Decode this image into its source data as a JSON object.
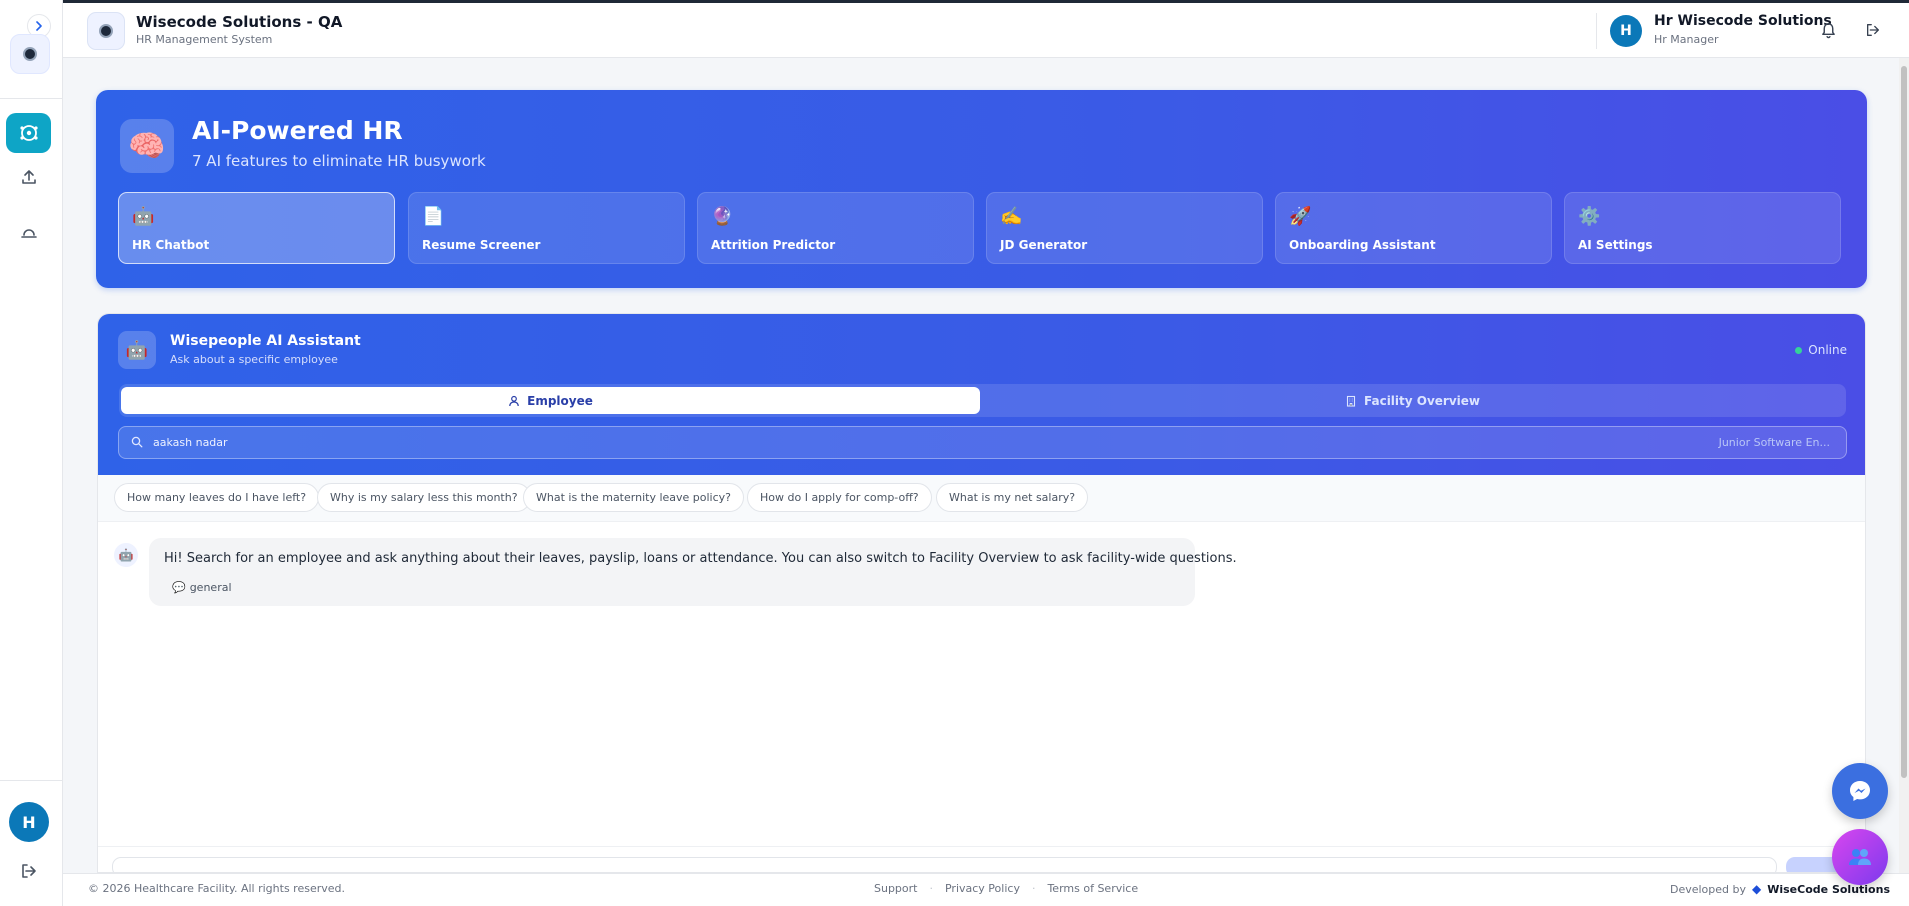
{
  "app": {
    "title": "Wisecode Solutions - QA",
    "subtitle": "HR Management System"
  },
  "user": {
    "initial": "H",
    "name": "Hr Wisecode Solutions",
    "role": "Hr Manager"
  },
  "sidebar": {
    "toggle_icon": "chevron-right-icon",
    "items": [
      {
        "name": "ai-icon",
        "active": true
      },
      {
        "name": "upload-icon",
        "active": false
      },
      {
        "name": "sunset-icon",
        "active": false
      }
    ],
    "avatar_initial": "H"
  },
  "hero": {
    "title": "AI-Powered HR",
    "subtitle": "7 AI features to eliminate HR busywork",
    "icon": "🧠",
    "features": [
      {
        "emoji": "🤖",
        "label": "HR Chatbot",
        "active": true
      },
      {
        "emoji": "📄",
        "label": "Resume Screener",
        "active": false
      },
      {
        "emoji": "🔮",
        "label": "Attrition Predictor",
        "active": false
      },
      {
        "emoji": "✍️",
        "label": "JD Generator",
        "active": false
      },
      {
        "emoji": "🚀",
        "label": "Onboarding Assistant",
        "active": false
      },
      {
        "emoji": "⚙️",
        "label": "AI Settings",
        "active": false
      }
    ]
  },
  "assistant": {
    "icon": "🤖",
    "title": "Wisepeople AI Assistant",
    "subtitle": "Ask about a specific employee",
    "status": "Online",
    "tabs": [
      {
        "label": "Employee",
        "active": true
      },
      {
        "label": "Facility Overview",
        "active": false
      }
    ],
    "search": {
      "value": "aakash nadar",
      "role": "Junior Software En..."
    },
    "suggestions": [
      "How many leaves do I have left?",
      "Why is my salary less this month?",
      "What is the maternity leave policy?",
      "How do I apply for comp-off?",
      "What is my net salary?"
    ],
    "messages": [
      {
        "avatar": "🤖",
        "text": "Hi! Search for an employee and ask anything about their leaves, payslip, loans or attendance. You can also switch to Facility Overview to ask facility-wide questions.",
        "tag": "general",
        "tag_icon": "💬"
      }
    ]
  },
  "footer": {
    "copyright": "© 2026 Healthcare Facility. All rights reserved.",
    "links": [
      "Support",
      "Privacy Policy",
      "Terms of Service"
    ],
    "separator": "·",
    "developed_by": "Developed by",
    "brand": "WiseCode Solutions"
  },
  "colors": {
    "primary": "#2f62e8",
    "accent": "#0ea5c6",
    "online": "#34d399",
    "avatar": "#0b78b8"
  }
}
